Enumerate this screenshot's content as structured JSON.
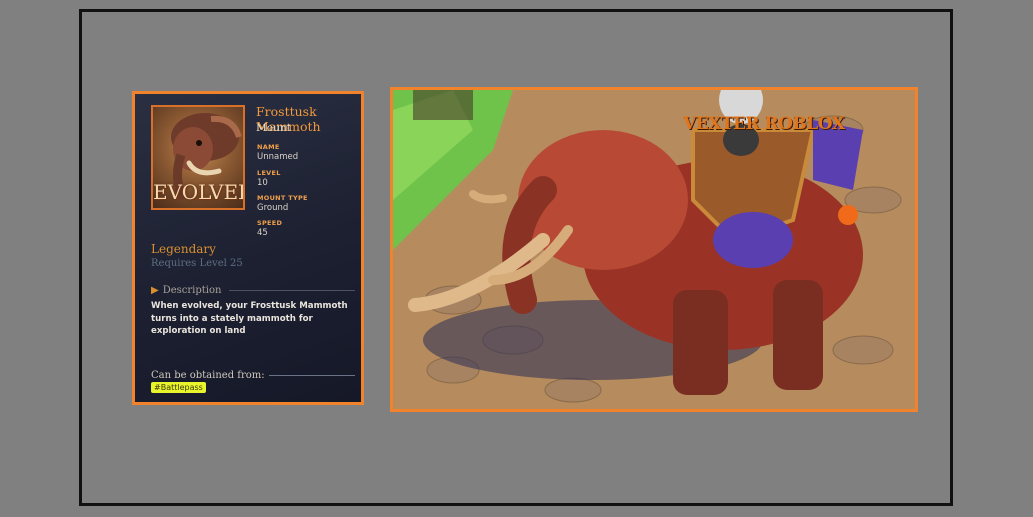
{
  "item": {
    "title": "Frosttusk Mammoth",
    "category": "Mount",
    "badge": "EVOLVED",
    "stats": [
      {
        "label": "NAME",
        "value": "Unnamed"
      },
      {
        "label": "LEVEL",
        "value": "10"
      },
      {
        "label": "MOUNT TYPE",
        "value": "Ground"
      },
      {
        "label": "SPEED",
        "value": "45"
      }
    ],
    "rarity": "Legendary",
    "requirement": "Requires Level 25",
    "description_label": "Description",
    "description": "When evolved, your Frosttusk Mammoth turns into a stately mammoth for exploration on land",
    "obtain_label": "Can be obtained from:",
    "obtain_tag": "#Battlepass"
  },
  "scene": {
    "watermark": "VEXTER ROBLOX"
  },
  "colors": {
    "accent": "#f0832b",
    "card_bg": "#1c2031",
    "tag_bg": "#e8f52a",
    "rarity": "#d9902f"
  }
}
